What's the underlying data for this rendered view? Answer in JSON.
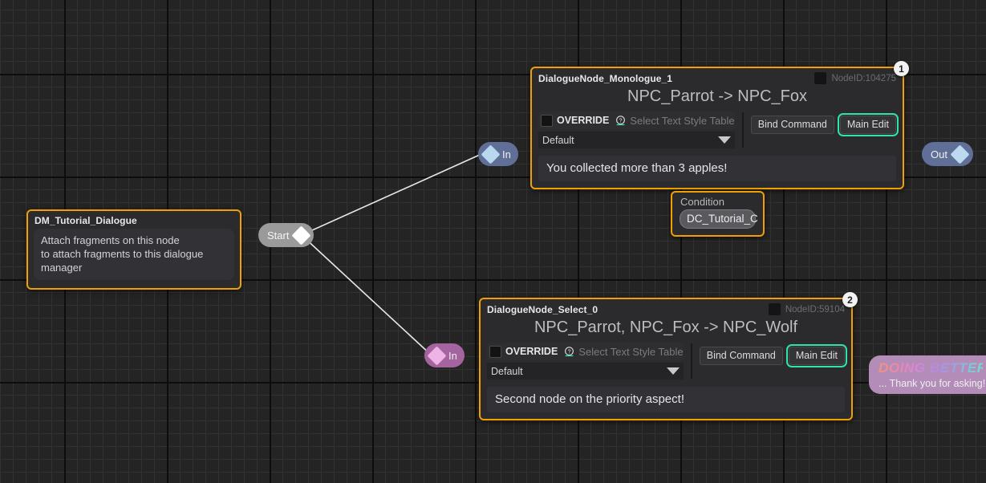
{
  "canvas": {
    "background_color": "#242424",
    "grid_minor_color": "#323232",
    "grid_major_color": "#0d0d0d",
    "wire_color": "#e8e8e8"
  },
  "dialogue_manager_node": {
    "title": "DM_Tutorial_Dialogue",
    "body_line_1": "Attach fragments on this node",
    "body_line_2": "to attach fragments to this dialogue manager",
    "border_color": "#f0a000"
  },
  "start_pin": {
    "label": "Start"
  },
  "monologue_node": {
    "badge": "1",
    "title": "DialogueNode_Monologue_1",
    "node_id": "NodeID:104275",
    "heading": "NPC_Parrot -> NPC_Fox",
    "override_label": "OVERRIDE",
    "help_icon": "help-circle-icon",
    "style_table_label": "Select Text Style Table",
    "style_table_value": "Default",
    "bind_command_label": "Bind Command",
    "main_edit_label": "Main Edit",
    "dialogue_text": "You collected more than 3 apples!",
    "border_color": "#f0a000",
    "accent_color": "#2fe3ac",
    "in_pin_label": "In",
    "out_pin_label": "Out"
  },
  "condition_node": {
    "label": "Condition",
    "value": "DC_Tutorial_C",
    "border_color": "#f0a000"
  },
  "select_node": {
    "badge": "2",
    "title": "DialogueNode_Select_0",
    "node_id": "NodeID:59104",
    "heading": "NPC_Parrot, NPC_Fox -> NPC_Wolf",
    "override_label": "OVERRIDE",
    "help_icon": "help-circle-icon",
    "style_table_label": "Select Text Style Table",
    "style_table_value": "Default",
    "bind_command_label": "Bind Command",
    "main_edit_label": "Main Edit",
    "dialogue_text": "Second node on the priority aspect!",
    "border_color": "#f0a000",
    "accent_color": "#2fe3ac",
    "in_pin_label": "In"
  },
  "edge_node": {
    "headline": "DOING BETTER T",
    "subline": "... Thank you for asking!!",
    "background_color": "#b38cb8"
  }
}
